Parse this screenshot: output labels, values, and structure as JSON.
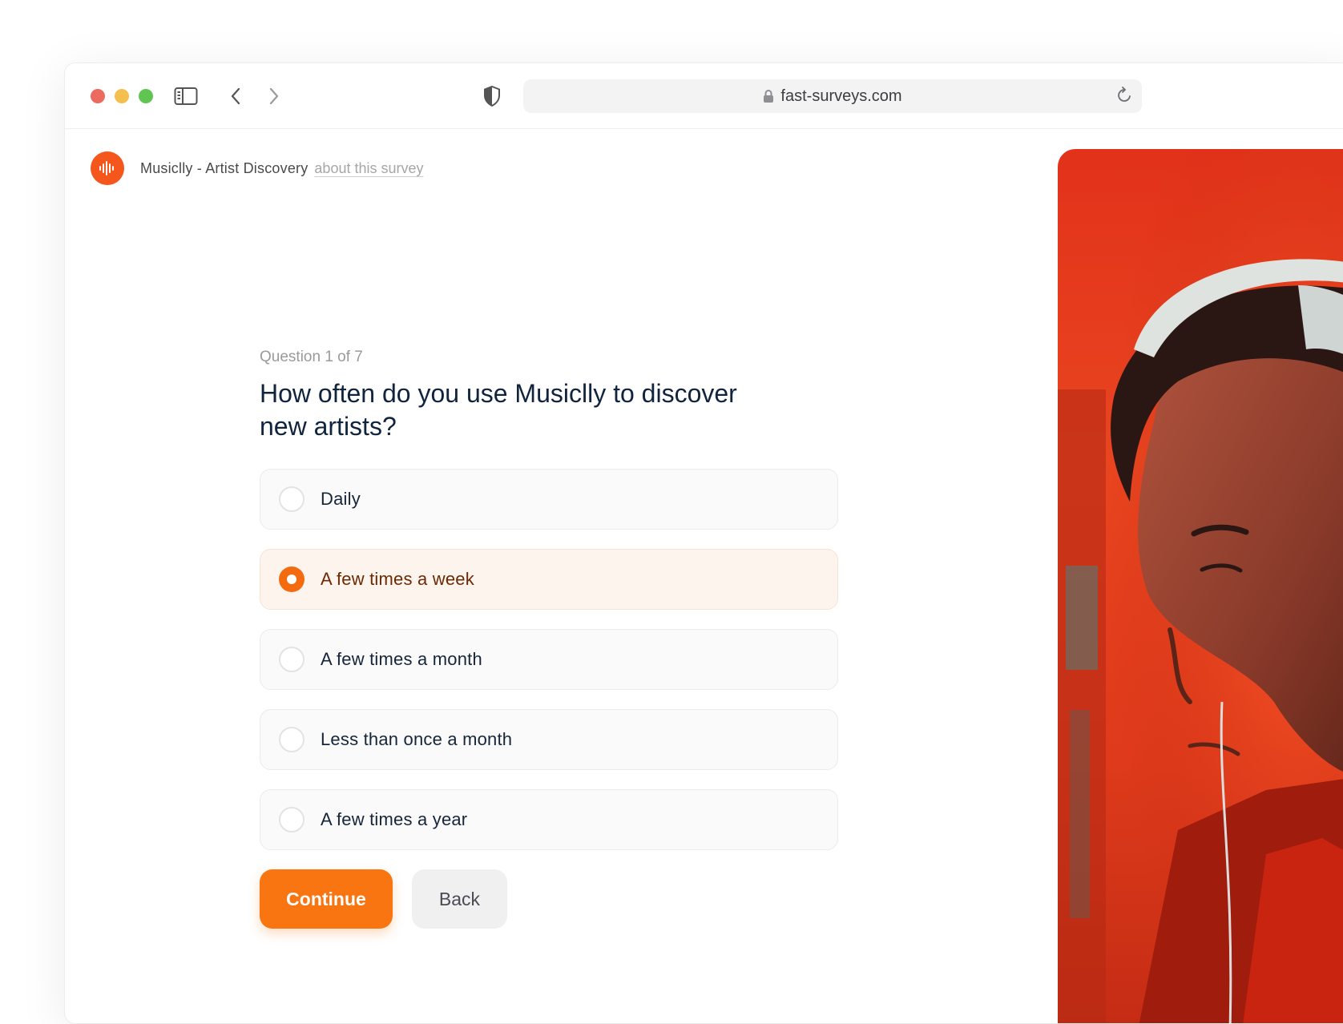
{
  "browser": {
    "url": "fast-surveys.com"
  },
  "survey": {
    "name": "Musiclly - Artist Discovery",
    "about_link": "about this survey"
  },
  "question": {
    "counter": "Question 1 of 7",
    "title": "How often do you use Musiclly to discover new artists?",
    "options": [
      {
        "label": "Daily",
        "selected": false
      },
      {
        "label": "A few times a week",
        "selected": true
      },
      {
        "label": "A few times a month",
        "selected": false
      },
      {
        "label": "Less than once a month",
        "selected": false
      },
      {
        "label": "A few times a year",
        "selected": false
      }
    ]
  },
  "buttons": {
    "continue": "Continue",
    "back": "Back"
  },
  "colors": {
    "accent": "#f97511",
    "logo": "#f4561b",
    "selected_bg": "#fdf4ed"
  }
}
